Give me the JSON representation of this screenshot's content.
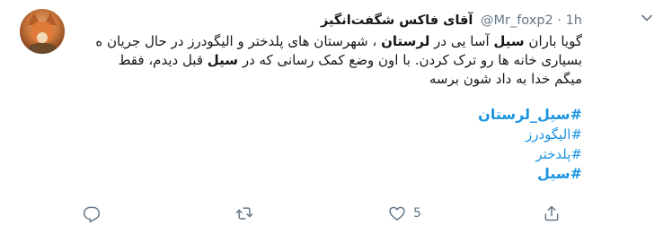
{
  "tweet": {
    "author_name": "آقای فاکس شگفت‌انگیز",
    "handle": "@Mr_foxp2",
    "separator": "·",
    "time": "1h",
    "body_lines": [
      [
        {
          "t": "گویا باران "
        },
        {
          "t": "سیل",
          "b": true
        },
        {
          "t": " آسا یی در "
        },
        {
          "t": "لرستان",
          "b": true
        },
        {
          "t": " ، شهرستان های پلدختر و الیگودرز در حال جریان ه"
        }
      ],
      [
        {
          "t": "بسیاری خانه ها رو ترک کردن. با اون وضع کمک رسانی که در "
        },
        {
          "t": "سیل",
          "b": true
        },
        {
          "t": " قبل دیدم، فقط"
        }
      ],
      [
        {
          "t": "میگم خدا به داد شون برسه"
        }
      ]
    ],
    "hashtags": [
      {
        "text": "#سیل_لرستان",
        "bold": true
      },
      {
        "text": "#الیگودرز",
        "bold": false
      },
      {
        "text": "#پلدختر",
        "bold": false
      },
      {
        "text": "#سیل",
        "bold": true
      }
    ],
    "actions": {
      "reply_count": "",
      "retweet_count": "",
      "like_count": "5",
      "share_count": ""
    },
    "accent_color": "#1b95e0",
    "muted_color": "#657786",
    "icons": [
      "avatar-fox",
      "chevron-down-icon",
      "reply-icon",
      "retweet-icon",
      "like-icon",
      "share-icon"
    ]
  }
}
